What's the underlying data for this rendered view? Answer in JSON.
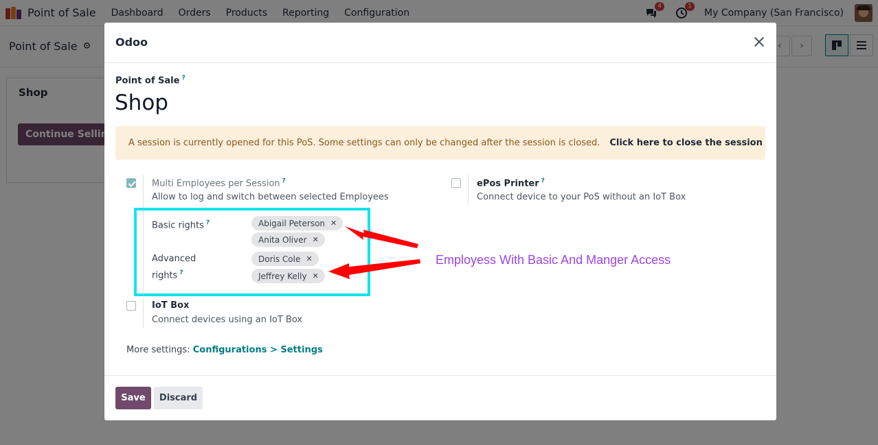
{
  "navbar": {
    "app_title": "Point of Sale",
    "menu": [
      "Dashboard",
      "Orders",
      "Products",
      "Reporting",
      "Configuration"
    ],
    "messages_badge": "4",
    "activities_badge": "1",
    "company": "My Company (San Francisco)"
  },
  "control_panel": {
    "title": "Point of Sale"
  },
  "kanban": {
    "card_title": "Shop",
    "continue_button": "Continue Selling"
  },
  "modal": {
    "title": "Odoo",
    "field_label": "Point of Sale",
    "help_mark": "?",
    "record_name": "Shop",
    "alert_text": "A session is currently opened for this PoS. Some settings can only be changed after the session is closed.",
    "alert_link": "Click here to close the session",
    "settings": {
      "multi_employees": {
        "title": "Multi Employees per Session",
        "description": "Allow to log and switch between selected Employees",
        "checked": true
      },
      "epos_printer": {
        "title": "ePos Printer",
        "description": "Connect device to your PoS without an IoT Box",
        "checked": false
      },
      "iot_box": {
        "title": "IoT Box",
        "description": "Connect devices using an IoT Box",
        "checked": false
      }
    },
    "basic_rights": {
      "label": "Basic rights",
      "tags": [
        "Abigail Peterson",
        "Anita Oliver"
      ]
    },
    "advanced_rights": {
      "label_line1": "Advanced",
      "label_line2": "rights",
      "tags": [
        "Doris Cole",
        "Jeffrey Kelly"
      ]
    },
    "tag_remove_glyph": "✕",
    "more_settings_prefix": "More settings:",
    "more_settings_link": "Configurations > Settings",
    "save_label": "Save",
    "discard_label": "Discard"
  },
  "annotation": {
    "text": "Employess With Basic And Manger Access",
    "box_color": "#14e3ec",
    "arrow_color": "#ff0000",
    "text_color": "#9b45e4"
  },
  "colors": {
    "brand": "#71496b",
    "link": "#017e84",
    "alert_bg": "#fcefdc"
  }
}
